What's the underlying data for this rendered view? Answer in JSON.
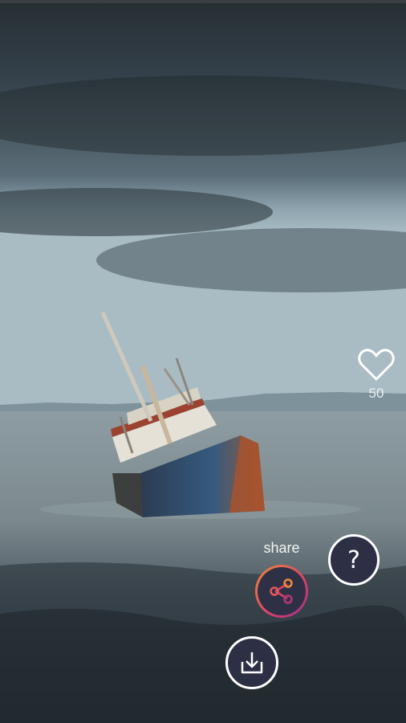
{
  "wallpaper": {
    "subject": "shipwreck-image"
  },
  "like": {
    "icon": "heart-outline-icon",
    "count": "50"
  },
  "share": {
    "label": "share",
    "icon": "share-icon",
    "ring_colors": [
      "#ef8a3a",
      "#d6426a",
      "#9a2f8c"
    ]
  },
  "help": {
    "glyph": "?",
    "icon": "help-icon"
  },
  "download": {
    "icon": "download-icon"
  },
  "colors": {
    "button_fill": "#2d3045",
    "button_border": "#ffffff"
  }
}
